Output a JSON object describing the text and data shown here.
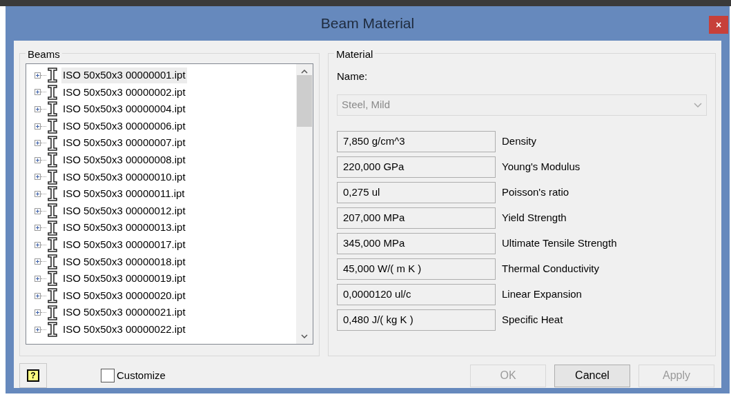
{
  "window": {
    "title": "Beam Material",
    "close": "×"
  },
  "beams": {
    "title": "Beams",
    "items": [
      {
        "name": "ISO 50x50x3 00000001.ipt",
        "selected": true
      },
      {
        "name": "ISO 50x50x3 00000002.ipt",
        "selected": false
      },
      {
        "name": "ISO 50x50x3 00000004.ipt",
        "selected": false
      },
      {
        "name": "ISO 50x50x3 00000006.ipt",
        "selected": false
      },
      {
        "name": "ISO 50x50x3 00000007.ipt",
        "selected": false
      },
      {
        "name": "ISO 50x50x3 00000008.ipt",
        "selected": false
      },
      {
        "name": "ISO 50x50x3 00000010.ipt",
        "selected": false
      },
      {
        "name": "ISO 50x50x3 00000011.ipt",
        "selected": false
      },
      {
        "name": "ISO 50x50x3 00000012.ipt",
        "selected": false
      },
      {
        "name": "ISO 50x50x3 00000013.ipt",
        "selected": false
      },
      {
        "name": "ISO 50x50x3 00000017.ipt",
        "selected": false
      },
      {
        "name": "ISO 50x50x3 00000018.ipt",
        "selected": false
      },
      {
        "name": "ISO 50x50x3 00000019.ipt",
        "selected": false
      },
      {
        "name": "ISO 50x50x3 00000020.ipt",
        "selected": false
      },
      {
        "name": "ISO 50x50x3 00000021.ipt",
        "selected": false
      },
      {
        "name": "ISO 50x50x3 00000022.ipt",
        "selected": false
      }
    ]
  },
  "material": {
    "title": "Material",
    "name_label": "Name:",
    "name_value": "Steel, Mild",
    "name_disabled": true,
    "properties": [
      {
        "value": "7,850 g/cm^3",
        "label": "Density"
      },
      {
        "value": "220,000 GPa",
        "label": "Young's Modulus"
      },
      {
        "value": "0,275 ul",
        "label": "Poisson's ratio"
      },
      {
        "value": "207,000 MPa",
        "label": "Yield Strength"
      },
      {
        "value": "345,000 MPa",
        "label": "Ultimate Tensile Strength"
      },
      {
        "value": "45,000 W/( m K )",
        "label": "Thermal Conductivity"
      },
      {
        "value": "0,0000120 ul/c",
        "label": "Linear Expansion"
      },
      {
        "value": "0,480 J/( kg K )",
        "label": "Specific Heat"
      }
    ]
  },
  "help": "?",
  "customize": {
    "label": "Customize",
    "checked": false
  },
  "buttons": [
    {
      "label": "OK",
      "disabled": true
    },
    {
      "label": "Cancel",
      "disabled": false
    },
    {
      "label": "Apply",
      "disabled": true
    }
  ]
}
